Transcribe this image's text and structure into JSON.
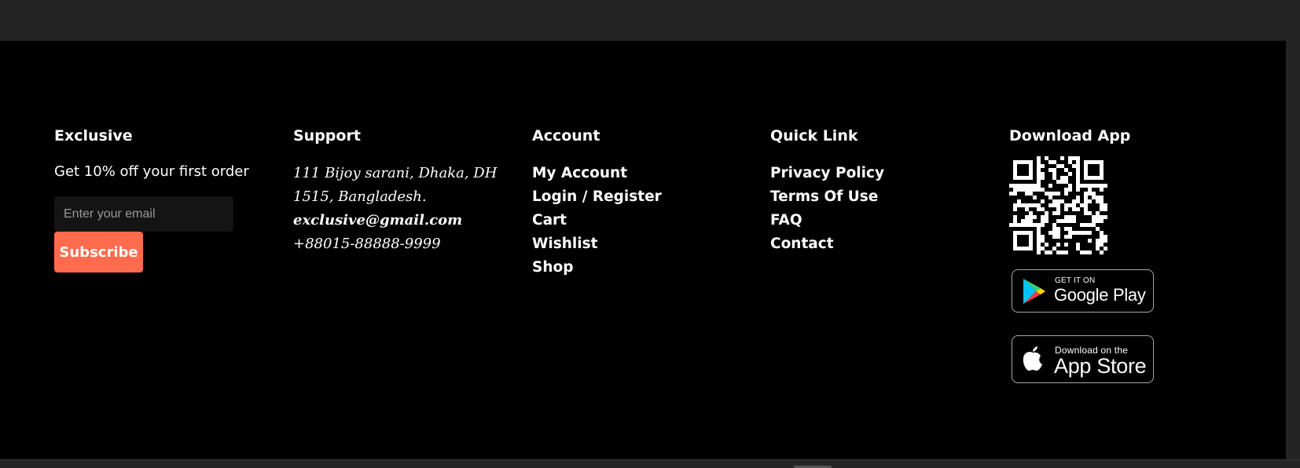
{
  "brand": {
    "title": "Exclusive",
    "offer": "Get 10% off your first order",
    "email_placeholder": "Enter your email",
    "subscribe_label": "Subscribe"
  },
  "support": {
    "title": "Support",
    "address_line1": "111 Bijoy sarani, Dhaka, DH",
    "address_line2": "1515, Bangladesh.",
    "email": "exclusive@gmail.com",
    "phone": "+88015-88888-9999"
  },
  "account": {
    "title": "Account",
    "items": [
      "My Account",
      "Login / Register",
      "Cart",
      "Wishlist",
      "Shop"
    ]
  },
  "quick_link": {
    "title": "Quick Link",
    "items": [
      "Privacy Policy",
      "Terms Of Use",
      "FAQ",
      "Contact"
    ]
  },
  "download_app": {
    "title": "Download App",
    "google_play": {
      "small": "GET IT ON",
      "big": "Google Play"
    },
    "app_store": {
      "small": "Download on the",
      "big": "App Store"
    }
  },
  "colors": {
    "accent": "#ff6b4c",
    "footer_bg": "#000000",
    "chrome_bg": "#242424"
  }
}
